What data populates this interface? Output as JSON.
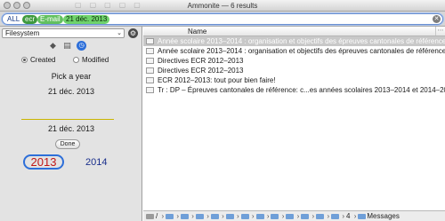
{
  "window": {
    "title": "Ammonite — 6 results"
  },
  "search": {
    "scope_label": "ALL",
    "tokens": [
      "ecr",
      "E-mail",
      "21 déc. 2013"
    ]
  },
  "sidebar": {
    "location": "Filesystem",
    "created_label": "Created",
    "modified_label": "Modified",
    "pick_label": "Pick a year",
    "date_primary": "21 déc. 2013",
    "date_secondary": "21 déc. 2013",
    "done_label": "Done",
    "year_selected": "2013",
    "year_other": "2014"
  },
  "results": {
    "column_header": "Name",
    "rows": [
      "Année scolaire 2013–2014 : organisation et objectifs des épreuves cantonales de référence",
      "Année scolaire 2013–2014 : organisation et objectifs des épreuves cantonales de référence",
      "Directives ECR 2012–2013",
      "Directives ECR 2012–2013",
      "ECR 2012–2013: tout pour bien faire!",
      "Tr : DP – Épreuves cantonales de référence: c...es années scolaires 2013–2014 et 2014–2015"
    ]
  },
  "pathbar": {
    "root": "/",
    "count": "4",
    "last": "Messages"
  },
  "icons": {
    "tag": "tag-icon",
    "doc": "document-icon",
    "clock": "clock-icon",
    "action": "action-menu-icon"
  }
}
